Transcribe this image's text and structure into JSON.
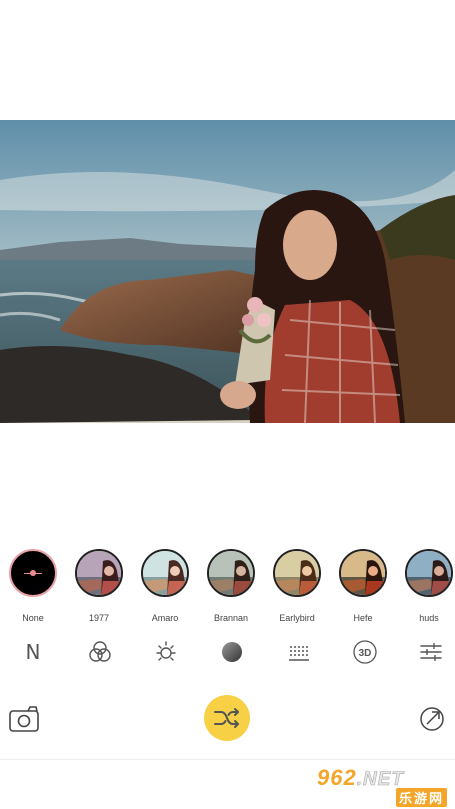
{
  "photo": {
    "description_icon": "beach-portrait-photo"
  },
  "filters": [
    {
      "label": "None",
      "kind": "none"
    },
    {
      "label": "1977",
      "kind": "warm"
    },
    {
      "label": "Amaro",
      "kind": "bright"
    },
    {
      "label": "Brannan",
      "kind": "muted"
    },
    {
      "label": "Earlybird",
      "kind": "sepia"
    },
    {
      "label": "Hefe",
      "kind": "contrast"
    },
    {
      "label": "huds",
      "kind": "cool"
    }
  ],
  "tools": {
    "n_label": "N",
    "three_d_label": "3D"
  },
  "watermark": {
    "top": "962",
    "top_suffix": ".NET",
    "bottom": "乐游网"
  },
  "colors": {
    "accent": "#f7d046",
    "selected_border": "#e9a3a8",
    "watermark": "#f3a629"
  }
}
